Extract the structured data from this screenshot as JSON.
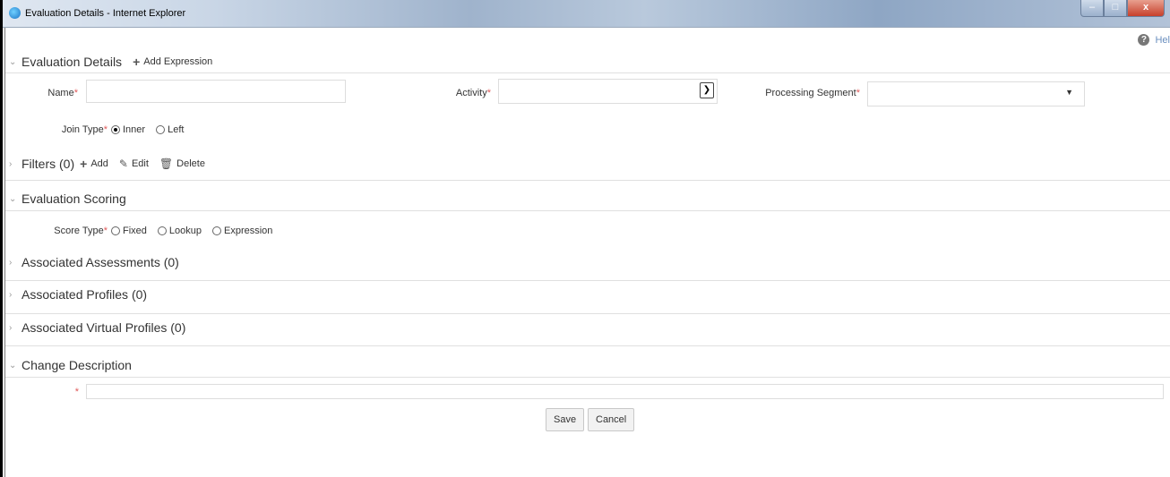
{
  "window": {
    "title": "Evaluation Details - Internet Explorer",
    "close_label": "x"
  },
  "help_label": "Hel",
  "evaluation_details": {
    "title": "Evaluation Details",
    "add_expression_label": "Add Expression",
    "name_label": "Name",
    "name_value": "",
    "activity_label": "Activity",
    "activity_value": "",
    "processing_segment_label": "Processing Segment",
    "processing_segment_value": "",
    "join_type_label": "Join Type",
    "join_type_options": [
      "Inner",
      "Left"
    ],
    "join_type_selected": "Inner",
    "required_marker": "*"
  },
  "filters": {
    "title": "Filters (0)",
    "add_label": "Add",
    "edit_label": "Edit",
    "delete_label": "Delete"
  },
  "evaluation_scoring": {
    "title": "Evaluation Scoring",
    "score_type_label": "Score Type",
    "score_type_options": [
      "Fixed",
      "Lookup",
      "Expression"
    ],
    "score_type_selected": ""
  },
  "associated_assessments": {
    "title": "Associated Assessments (0)"
  },
  "associated_profiles": {
    "title": "Associated Profiles (0)"
  },
  "associated_virtual_profiles": {
    "title": "Associated Virtual Profiles (0)"
  },
  "change_description": {
    "title": "Change Description",
    "value": ""
  },
  "buttons": {
    "save_label": "Save",
    "cancel_label": "Cancel"
  },
  "icons": {
    "expanded": "chevron-down-icon",
    "collapsed": "chevron-right-icon",
    "add": "plus-icon",
    "edit": "edit-icon",
    "delete": "trash-icon",
    "help": "help-icon"
  }
}
